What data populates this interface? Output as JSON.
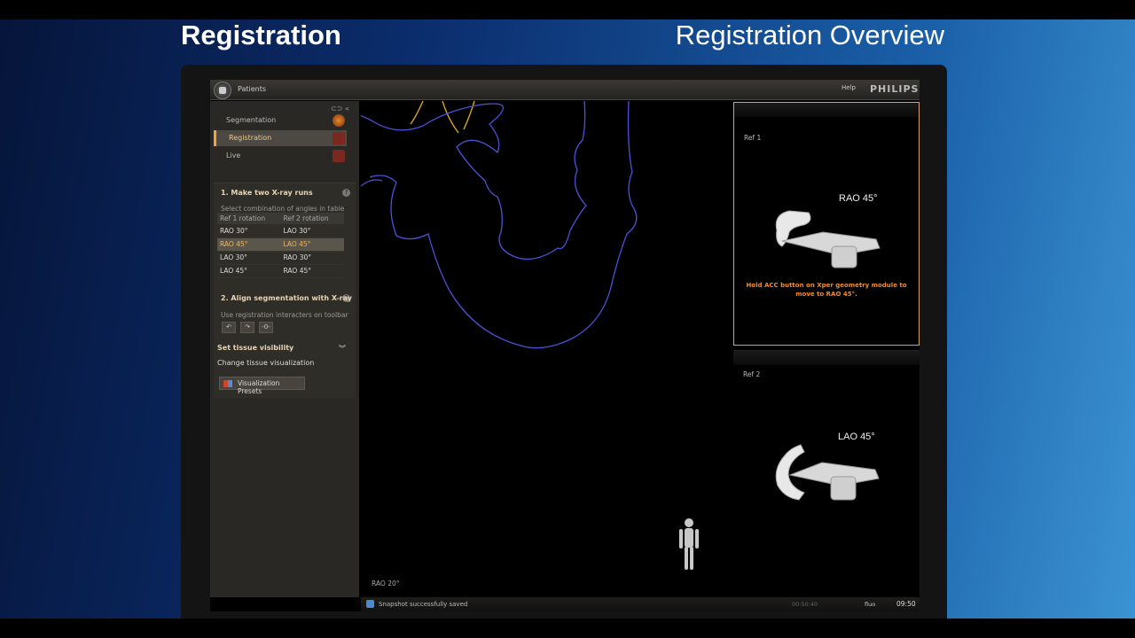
{
  "slide": {
    "title": "Registration",
    "subtitle": "Registration Overview"
  },
  "app": {
    "patients_label": "Patients",
    "help_label": "Help",
    "brand": "PHILIPS"
  },
  "nav": {
    "items": [
      {
        "label": "Segmentation",
        "active": false
      },
      {
        "label": "Registration",
        "active": true
      },
      {
        "label": "Live",
        "active": false
      }
    ]
  },
  "step1": {
    "title": "1.  Make two X-ray runs",
    "hint": "Select combination of angles in table",
    "headers": [
      "Ref 1 rotation",
      "Ref 2 rotation"
    ],
    "rows": [
      [
        "RAO  30°",
        "LAO  30°"
      ],
      [
        "RAO  45°",
        "LAO  45°"
      ],
      [
        "LAO  30°",
        "RAO  30°"
      ],
      [
        "LAO  45°",
        "RAO  45°"
      ]
    ],
    "selected_row": 1
  },
  "step2": {
    "title": "2.  Align segmentation with X-ray",
    "hint": "Use registration interacters on toolbar",
    "tools": [
      "↶",
      "↷",
      "-0-"
    ]
  },
  "tissue": {
    "section_title": "Set tissue visibility",
    "subtitle": "Change tissue visualization",
    "button_label": "Visualization Presets"
  },
  "center_view": {
    "angle": "RAO  20°"
  },
  "ref1": {
    "label": "Ref 1",
    "angle": "RAO  45°",
    "message": "Hold ACC button on Xper geometry module to move to RAO  45°."
  },
  "ref2": {
    "label": "Ref 2",
    "angle": "LAO  45°"
  },
  "status": {
    "message": "Snapshot successfully saved",
    "elapsed": "00:50:40",
    "fluoro": "fluo",
    "clock": "09:50"
  },
  "colors": {
    "accent": "#f5a23a",
    "contour": "#4a52d8",
    "vessel": "#d9a22a"
  }
}
